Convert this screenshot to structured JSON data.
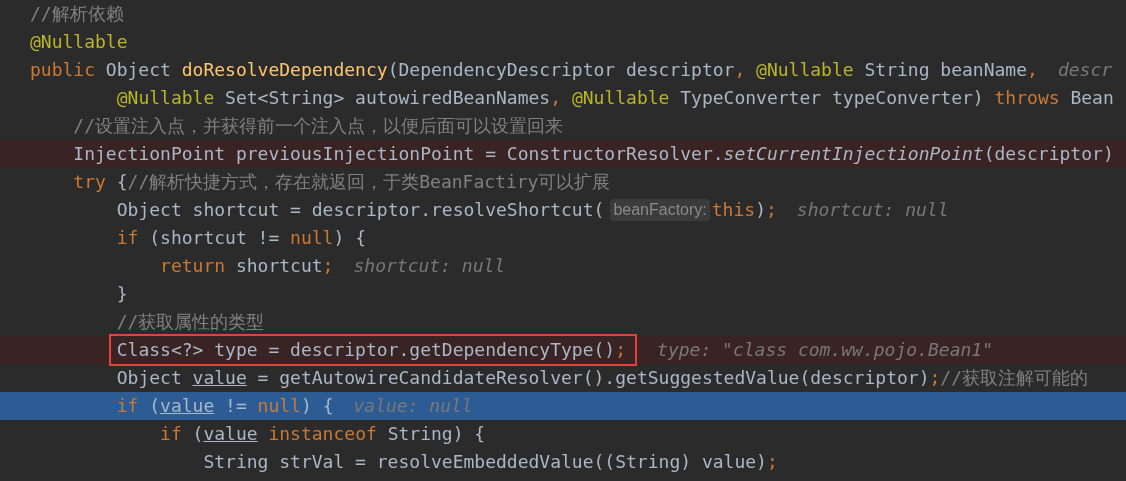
{
  "lines": [
    {
      "breakpoint": false,
      "execution": false,
      "boxed": false,
      "segments": [
        {
          "kind": "code",
          "tokens": [
            {
              "kind": "comment",
              "text": "//解析依赖"
            }
          ]
        }
      ]
    },
    {
      "breakpoint": false,
      "execution": false,
      "boxed": false,
      "segments": [
        {
          "kind": "code",
          "tokens": [
            {
              "kind": "annotation",
              "text": "@Nullable"
            }
          ]
        }
      ]
    },
    {
      "breakpoint": false,
      "execution": false,
      "boxed": false,
      "segments": [
        {
          "kind": "code",
          "tokens": [
            {
              "kind": "keyword",
              "text": "public "
            },
            {
              "kind": "plain",
              "text": "Object "
            },
            {
              "kind": "method",
              "text": "doResolveDependency"
            },
            {
              "kind": "plain",
              "text": "(DependencyDescriptor descriptor"
            },
            {
              "kind": "keyword",
              "text": ", "
            },
            {
              "kind": "annotation",
              "text": "@Nullable "
            },
            {
              "kind": "plain",
              "text": "String beanName"
            },
            {
              "kind": "keyword",
              "text": ","
            }
          ]
        },
        {
          "kind": "value_hint",
          "text": "descr"
        }
      ]
    },
    {
      "breakpoint": false,
      "execution": false,
      "boxed": false,
      "segments": [
        {
          "kind": "code",
          "tokens": [
            {
              "kind": "annotation",
              "text": "        @Nullable "
            },
            {
              "kind": "plain",
              "text": "Set<String> autowiredBeanNames"
            },
            {
              "kind": "keyword",
              "text": ", "
            },
            {
              "kind": "annotation",
              "text": "@Nullable "
            },
            {
              "kind": "plain",
              "text": "TypeConverter typeConverter) "
            },
            {
              "kind": "keyword",
              "text": "throws "
            },
            {
              "kind": "plain",
              "text": "Bean"
            }
          ]
        }
      ]
    },
    {
      "breakpoint": false,
      "execution": false,
      "boxed": false,
      "segments": [
        {
          "kind": "code",
          "tokens": [
            {
              "kind": "comment",
              "text": "    //设置注入点，并获得前一个注入点，以便后面可以设置回来"
            }
          ]
        }
      ]
    },
    {
      "breakpoint": true,
      "execution": false,
      "boxed": false,
      "segments": [
        {
          "kind": "code",
          "tokens": [
            {
              "kind": "plain",
              "text": "    InjectionPoint previousInjectionPoint = ConstructorResolver."
            },
            {
              "kind": "static",
              "text": "setCurrentInjectionPoint"
            },
            {
              "kind": "plain",
              "text": "(descriptor)"
            }
          ]
        }
      ]
    },
    {
      "breakpoint": false,
      "execution": false,
      "boxed": false,
      "segments": [
        {
          "kind": "code",
          "tokens": [
            {
              "kind": "keyword",
              "text": "    try "
            },
            {
              "kind": "plain",
              "text": "{"
            },
            {
              "kind": "comment",
              "text": "//解析快捷方式，存在就返回，于类BeanFactiry可以扩展"
            }
          ]
        }
      ]
    },
    {
      "breakpoint": false,
      "execution": false,
      "boxed": false,
      "segments": [
        {
          "kind": "code",
          "tokens": [
            {
              "kind": "plain",
              "text": "        Object shortcut = descriptor.resolveShortcut("
            }
          ]
        },
        {
          "kind": "param_hint",
          "text": "beanFactory:"
        },
        {
          "kind": "code",
          "tokens": [
            {
              "kind": "keyword",
              "text": "this"
            },
            {
              "kind": "plain",
              "text": ")"
            },
            {
              "kind": "keyword",
              "text": ";"
            }
          ]
        },
        {
          "kind": "value_hint",
          "text": "shortcut: null"
        }
      ]
    },
    {
      "breakpoint": false,
      "execution": false,
      "boxed": false,
      "segments": [
        {
          "kind": "code",
          "tokens": [
            {
              "kind": "keyword",
              "text": "        if "
            },
            {
              "kind": "plain",
              "text": "(shortcut != "
            },
            {
              "kind": "keyword",
              "text": "null"
            },
            {
              "kind": "plain",
              "text": ") {"
            }
          ]
        }
      ]
    },
    {
      "breakpoint": false,
      "execution": false,
      "boxed": false,
      "segments": [
        {
          "kind": "code",
          "tokens": [
            {
              "kind": "keyword",
              "text": "            return "
            },
            {
              "kind": "plain",
              "text": "shortcut"
            },
            {
              "kind": "keyword",
              "text": ";"
            }
          ]
        },
        {
          "kind": "value_hint",
          "text": "shortcut: null"
        }
      ]
    },
    {
      "breakpoint": false,
      "execution": false,
      "boxed": false,
      "segments": [
        {
          "kind": "code",
          "tokens": [
            {
              "kind": "plain",
              "text": "        }"
            }
          ]
        }
      ]
    },
    {
      "breakpoint": false,
      "execution": false,
      "boxed": false,
      "segments": [
        {
          "kind": "code",
          "tokens": [
            {
              "kind": "comment",
              "text": "        //获取属性的类型"
            }
          ]
        }
      ]
    },
    {
      "breakpoint": true,
      "execution": false,
      "boxed": true,
      "segments": [
        {
          "kind": "code",
          "tokens": [
            {
              "kind": "plain",
              "text": "        Class<?> type = descriptor.getDependencyType()"
            },
            {
              "kind": "keyword",
              "text": ";"
            }
          ]
        },
        {
          "kind": "value_hint",
          "text": "type: \"class com.ww.pojo.Bean1\""
        }
      ]
    },
    {
      "breakpoint": false,
      "execution": false,
      "boxed": false,
      "segments": [
        {
          "kind": "code",
          "tokens": [
            {
              "kind": "plain",
              "text": "        Object "
            },
            {
              "kind": "underlined",
              "text": "value"
            },
            {
              "kind": "plain",
              "text": " = getAutowireCandidateResolver().getSuggestedValue(descriptor)"
            },
            {
              "kind": "keyword",
              "text": ";"
            },
            {
              "kind": "comment",
              "text": "//获取注解可能的"
            }
          ]
        }
      ]
    },
    {
      "breakpoint": false,
      "execution": true,
      "boxed": false,
      "segments": [
        {
          "kind": "code",
          "tokens": [
            {
              "kind": "keyword",
              "text": "        if "
            },
            {
              "kind": "plain",
              "text": "("
            },
            {
              "kind": "underlined",
              "text": "value"
            },
            {
              "kind": "plain",
              "text": " != "
            },
            {
              "kind": "keyword",
              "text": "null"
            },
            {
              "kind": "plain",
              "text": ") {"
            }
          ]
        },
        {
          "kind": "value_hint",
          "text": "value: null"
        }
      ]
    },
    {
      "breakpoint": false,
      "execution": false,
      "boxed": false,
      "segments": [
        {
          "kind": "code",
          "tokens": [
            {
              "kind": "keyword",
              "text": "            if "
            },
            {
              "kind": "plain",
              "text": "("
            },
            {
              "kind": "underlined",
              "text": "value"
            },
            {
              "kind": "keyword",
              "text": " instanceof "
            },
            {
              "kind": "plain",
              "text": "String) {"
            }
          ]
        }
      ]
    },
    {
      "breakpoint": false,
      "execution": false,
      "boxed": false,
      "segments": [
        {
          "kind": "code",
          "tokens": [
            {
              "kind": "plain",
              "text": "                String strVal = resolveEmbeddedValue((String) value)"
            },
            {
              "kind": "keyword",
              "text": ";"
            }
          ]
        }
      ]
    }
  ]
}
